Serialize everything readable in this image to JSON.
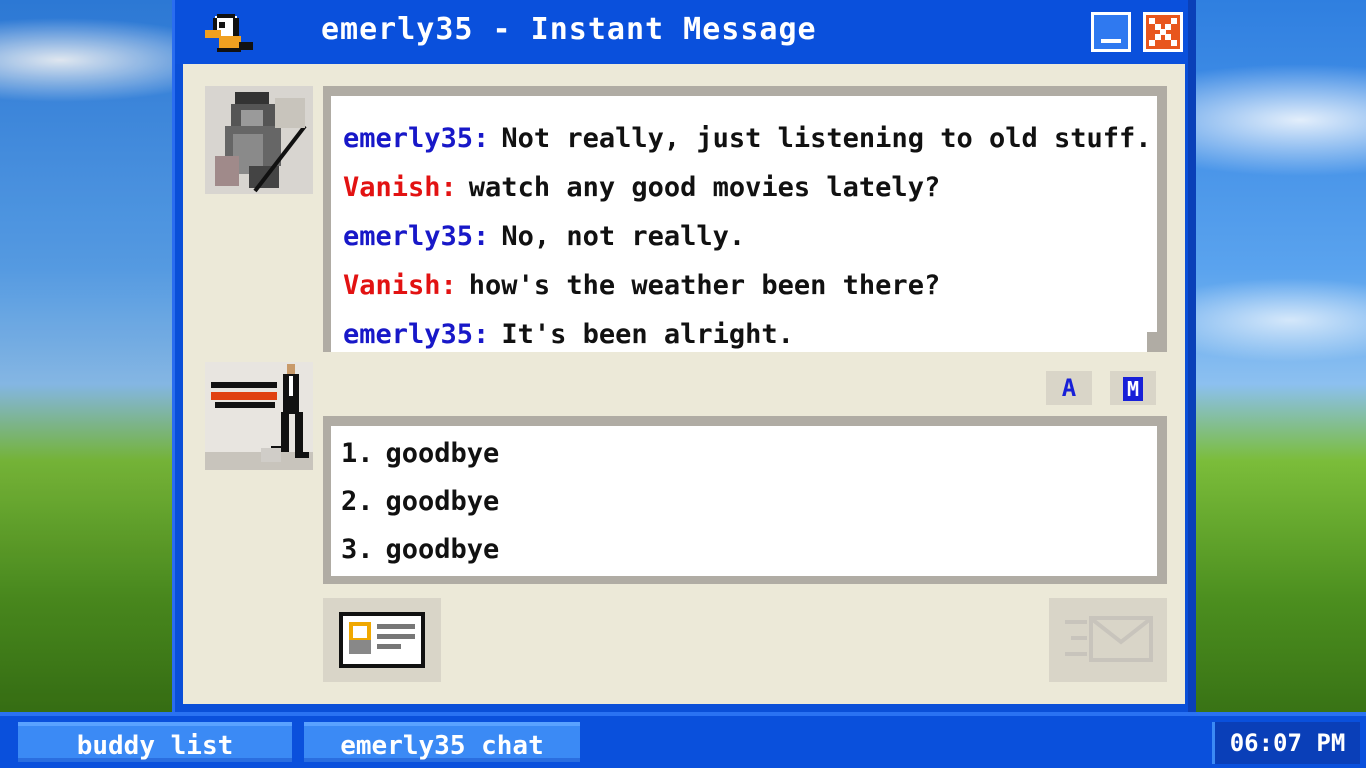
{
  "window": {
    "title": "emerly35 - Instant Message",
    "icon": "duck-icon",
    "minimize_icon": "minimize-icon",
    "close_icon": "close-icon"
  },
  "chat": {
    "messages": [
      {
        "sender": "emerly35:",
        "text": "Not really, just listening to old stuff.",
        "role": "self"
      },
      {
        "sender": "Vanish:",
        "text": "watch any good movies lately?",
        "role": "buddy"
      },
      {
        "sender": "emerly35:",
        "text": "No, not really.",
        "role": "self"
      },
      {
        "sender": "Vanish:",
        "text": "how's the weather been there?",
        "role": "buddy"
      },
      {
        "sender": "emerly35:",
        "text": "It's been alright.",
        "role": "self"
      }
    ]
  },
  "format": {
    "font_label": "A",
    "style_label": "M"
  },
  "replies": [
    {
      "num": "1.",
      "text": "goodbye"
    },
    {
      "num": "2.",
      "text": "goodbye"
    },
    {
      "num": "3.",
      "text": "goodbye"
    }
  ],
  "buttons": {
    "profile_icon": "profile-card-icon",
    "send_icon": "envelope-send-icon"
  },
  "taskbar": {
    "items": [
      {
        "label": "buddy list"
      },
      {
        "label": "emerly35 chat"
      }
    ],
    "clock": "06:07 PM"
  },
  "colors": {
    "self_name": "#1818c8",
    "buddy_name": "#e21212",
    "window_blue": "#0a50dc",
    "client_bg": "#ece9d8"
  }
}
